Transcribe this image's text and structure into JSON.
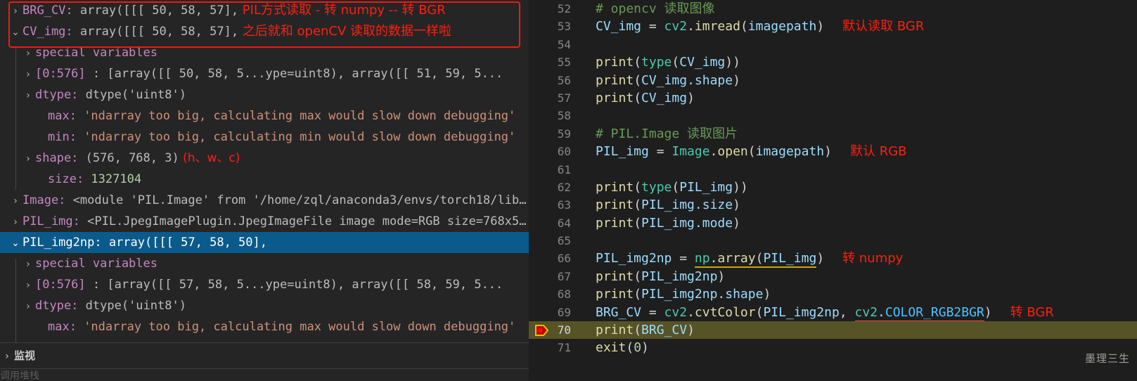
{
  "debug_panel": {
    "variables": [
      {
        "indent": 1,
        "chevron": "›",
        "expanded": false,
        "name": "BRG_CV:",
        "value": "array([[[ 50,  58,  57],",
        "annotation": "PIL方式读取 - 转 numpy -- 转 BGR",
        "selected": false,
        "value_kind": "plain"
      },
      {
        "indent": 1,
        "chevron": "⌄",
        "expanded": true,
        "name": "CV_img:",
        "value": "array([[[ 50,  58,  57],",
        "annotation": "之后就和 openCV 读取的数据一样啦",
        "selected": false,
        "value_kind": "plain"
      },
      {
        "indent": 2,
        "chevron": "›",
        "expanded": false,
        "name": "special variables",
        "value": "",
        "annotation": "",
        "selected": false,
        "value_kind": "plain"
      },
      {
        "indent": 2,
        "chevron": "›",
        "expanded": false,
        "name": "[0:576]",
        "value": ": [array([[ 50,  58,  5...ype=uint8), array([[ 51,  59,  5...",
        "annotation": "",
        "selected": false,
        "value_kind": "plain"
      },
      {
        "indent": 2,
        "chevron": "›",
        "expanded": false,
        "name": "dtype:",
        "value": "dtype('uint8')",
        "annotation": "",
        "selected": false,
        "value_kind": "plain"
      },
      {
        "indent": 3,
        "chevron": "",
        "expanded": false,
        "name": "max:",
        "value": "'ndarray too big, calculating max would slow down debugging'",
        "annotation": "",
        "selected": false,
        "value_kind": "str"
      },
      {
        "indent": 3,
        "chevron": "",
        "expanded": false,
        "name": "min:",
        "value": "'ndarray too big, calculating min would slow down debugging'",
        "annotation": "",
        "selected": false,
        "value_kind": "str"
      },
      {
        "indent": 2,
        "chevron": "›",
        "expanded": false,
        "name": "shape:",
        "value": "(576, 768, 3)",
        "annotation": "(h、w、c)",
        "selected": false,
        "value_kind": "plain"
      },
      {
        "indent": 3,
        "chevron": "",
        "expanded": false,
        "name": "size:",
        "value": "1327104",
        "annotation": "",
        "selected": false,
        "value_kind": "num"
      },
      {
        "indent": 1,
        "chevron": "›",
        "expanded": false,
        "name": "Image:",
        "value": "<module 'PIL.Image' from '/home/zql/anaconda3/envs/torch18/lib…",
        "annotation": "",
        "selected": false,
        "value_kind": "plain"
      },
      {
        "indent": 1,
        "chevron": "›",
        "expanded": false,
        "name": "PIL_img:",
        "value": "<PIL.JpegImagePlugin.JpegImageFile image mode=RGB size=768x5…",
        "annotation": "",
        "selected": false,
        "value_kind": "plain"
      },
      {
        "indent": 1,
        "chevron": "⌄",
        "expanded": true,
        "name": "PIL_img2np:",
        "value": "array([[[ 57,  58,  50],",
        "annotation": "",
        "selected": true,
        "value_kind": "plain"
      },
      {
        "indent": 2,
        "chevron": "›",
        "expanded": false,
        "name": "special variables",
        "value": "",
        "annotation": "",
        "selected": false,
        "value_kind": "plain"
      },
      {
        "indent": 2,
        "chevron": "›",
        "expanded": false,
        "name": "[0:576]",
        "value": ": [array([[ 57,  58,  5...ype=uint8), array([[ 58,  59,  5...",
        "annotation": "",
        "selected": false,
        "value_kind": "plain"
      },
      {
        "indent": 2,
        "chevron": "›",
        "expanded": false,
        "name": "dtype:",
        "value": "dtype('uint8')",
        "annotation": "",
        "selected": false,
        "value_kind": "plain"
      },
      {
        "indent": 3,
        "chevron": "",
        "expanded": false,
        "name": "max:",
        "value": "'ndarray too big, calculating max would slow down debugging'",
        "annotation": "",
        "selected": false,
        "value_kind": "str"
      }
    ],
    "watch": {
      "chevron": "›",
      "label": "监视",
      "ghost_label": "调用堆栈"
    }
  },
  "editor": {
    "lines": [
      {
        "num": "52",
        "current": false,
        "tokens": [
          {
            "t": "# opencv 读取图像",
            "c": "t-com"
          }
        ],
        "annotation": ""
      },
      {
        "num": "53",
        "current": false,
        "tokens": [
          {
            "t": "CV_img",
            "c": "t-var"
          },
          {
            "t": " = ",
            "c": "t-op"
          },
          {
            "t": "cv2",
            "c": "t-mod"
          },
          {
            "t": ".",
            "c": "t-punc"
          },
          {
            "t": "imread",
            "c": "t-fn"
          },
          {
            "t": "(",
            "c": "t-punc"
          },
          {
            "t": "imagepath",
            "c": "t-var"
          },
          {
            "t": ")",
            "c": "t-punc"
          }
        ],
        "annotation": "默认读取 BGR"
      },
      {
        "num": "54",
        "current": false,
        "tokens": [],
        "annotation": ""
      },
      {
        "num": "55",
        "current": false,
        "tokens": [
          {
            "t": "print",
            "c": "t-fn"
          },
          {
            "t": "(",
            "c": "t-punc"
          },
          {
            "t": "type",
            "c": "t-mod"
          },
          {
            "t": "(",
            "c": "t-punc"
          },
          {
            "t": "CV_img",
            "c": "t-var"
          },
          {
            "t": "))",
            "c": "t-punc"
          }
        ],
        "annotation": ""
      },
      {
        "num": "56",
        "current": false,
        "tokens": [
          {
            "t": "print",
            "c": "t-fn"
          },
          {
            "t": "(",
            "c": "t-punc"
          },
          {
            "t": "CV_img",
            "c": "t-var"
          },
          {
            "t": ".shape",
            "c": "t-var"
          },
          {
            "t": ")",
            "c": "t-punc"
          }
        ],
        "annotation": ""
      },
      {
        "num": "57",
        "current": false,
        "tokens": [
          {
            "t": "print",
            "c": "t-fn"
          },
          {
            "t": "(",
            "c": "t-punc"
          },
          {
            "t": "CV_img",
            "c": "t-var"
          },
          {
            "t": ")",
            "c": "t-punc"
          }
        ],
        "annotation": ""
      },
      {
        "num": "58",
        "current": false,
        "tokens": [],
        "annotation": ""
      },
      {
        "num": "59",
        "current": false,
        "tokens": [
          {
            "t": "# PIL.Image 读取图片",
            "c": "t-com"
          }
        ],
        "annotation": ""
      },
      {
        "num": "60",
        "current": false,
        "tokens": [
          {
            "t": "PIL_img",
            "c": "t-var"
          },
          {
            "t": " = ",
            "c": "t-op"
          },
          {
            "t": "Image",
            "c": "t-mod"
          },
          {
            "t": ".",
            "c": "t-punc"
          },
          {
            "t": "open",
            "c": "t-fn"
          },
          {
            "t": "(",
            "c": "t-punc"
          },
          {
            "t": "imagepath",
            "c": "t-var"
          },
          {
            "t": ")",
            "c": "t-punc"
          }
        ],
        "annotation": "默认 RGB"
      },
      {
        "num": "61",
        "current": false,
        "tokens": [],
        "annotation": ""
      },
      {
        "num": "62",
        "current": false,
        "tokens": [
          {
            "t": "print",
            "c": "t-fn"
          },
          {
            "t": "(",
            "c": "t-punc"
          },
          {
            "t": "type",
            "c": "t-mod"
          },
          {
            "t": "(",
            "c": "t-punc"
          },
          {
            "t": "PIL_img",
            "c": "t-var"
          },
          {
            "t": "))",
            "c": "t-punc"
          }
        ],
        "annotation": ""
      },
      {
        "num": "63",
        "current": false,
        "tokens": [
          {
            "t": "print",
            "c": "t-fn"
          },
          {
            "t": "(",
            "c": "t-punc"
          },
          {
            "t": "PIL_img",
            "c": "t-var"
          },
          {
            "t": ".size",
            "c": "t-var"
          },
          {
            "t": ")",
            "c": "t-punc"
          }
        ],
        "annotation": ""
      },
      {
        "num": "64",
        "current": false,
        "tokens": [
          {
            "t": "print",
            "c": "t-fn"
          },
          {
            "t": "(",
            "c": "t-punc"
          },
          {
            "t": "PIL_img",
            "c": "t-var"
          },
          {
            "t": ".mode",
            "c": "t-var"
          },
          {
            "t": ")",
            "c": "t-punc"
          }
        ],
        "annotation": ""
      },
      {
        "num": "65",
        "current": false,
        "tokens": [],
        "annotation": ""
      },
      {
        "num": "66",
        "current": false,
        "tokens": [
          {
            "t": "PIL_img2np",
            "c": "t-var"
          },
          {
            "t": " = ",
            "c": "t-op"
          },
          {
            "t": "np",
            "c": "t-mod squig-warn"
          },
          {
            "t": ".",
            "c": "t-punc squig-warn"
          },
          {
            "t": "array",
            "c": "t-fn squig-warn"
          },
          {
            "t": "(",
            "c": "t-punc squig-warn"
          },
          {
            "t": "PIL_img",
            "c": "t-var squig-warn"
          },
          {
            "t": ")",
            "c": "t-punc"
          }
        ],
        "annotation": "转 numpy"
      },
      {
        "num": "67",
        "current": false,
        "tokens": [
          {
            "t": "print",
            "c": "t-fn"
          },
          {
            "t": "(",
            "c": "t-punc"
          },
          {
            "t": "PIL_img2np",
            "c": "t-var"
          },
          {
            "t": ")",
            "c": "t-punc"
          }
        ],
        "annotation": ""
      },
      {
        "num": "68",
        "current": false,
        "tokens": [
          {
            "t": "print",
            "c": "t-fn"
          },
          {
            "t": "(",
            "c": "t-punc"
          },
          {
            "t": "PIL_img2np",
            "c": "t-var"
          },
          {
            "t": ".shape",
            "c": "t-var"
          },
          {
            "t": ")",
            "c": "t-punc"
          }
        ],
        "annotation": ""
      },
      {
        "num": "69",
        "current": false,
        "tokens": [
          {
            "t": "BRG_CV",
            "c": "t-var"
          },
          {
            "t": " = ",
            "c": "t-op"
          },
          {
            "t": "cv2",
            "c": "t-mod"
          },
          {
            "t": ".",
            "c": "t-punc"
          },
          {
            "t": "cvtColor",
            "c": "t-fn"
          },
          {
            "t": "(",
            "c": "t-punc"
          },
          {
            "t": "PIL_img2np",
            "c": "t-var"
          },
          {
            "t": ", ",
            "c": "t-punc"
          },
          {
            "t": "cv2",
            "c": "t-mod squig-err"
          },
          {
            "t": ".",
            "c": "t-punc squig-err"
          },
          {
            "t": "COLOR_RGB2BGR",
            "c": "t-const squig-err"
          },
          {
            "t": ")",
            "c": "t-punc"
          }
        ],
        "annotation": "转 BGR"
      },
      {
        "num": "70",
        "current": true,
        "tokens": [
          {
            "t": "print",
            "c": "t-fn"
          },
          {
            "t": "(",
            "c": "t-punc"
          },
          {
            "t": "BRG_CV",
            "c": "t-var"
          },
          {
            "t": ")",
            "c": "t-punc"
          }
        ],
        "annotation": ""
      },
      {
        "num": "71",
        "current": false,
        "tokens": [
          {
            "t": "exit",
            "c": "t-fn"
          },
          {
            "t": "(",
            "c": "t-punc"
          },
          {
            "t": "0",
            "c": "t-num"
          },
          {
            "t": ")",
            "c": "t-punc"
          }
        ],
        "annotation": ""
      }
    ],
    "debug_pointer_line": "70",
    "watermark": "墨理三生"
  },
  "colors": {
    "annotation_red": "#ff1f0f",
    "selection_blue": "#0a5a8c",
    "current_line": "#565327",
    "editor_bg": "#1e1e1e",
    "panel_bg": "#252526",
    "comment_green": "#6a9955",
    "variable_blue": "#9cdcfe",
    "function_yellow": "#dcdcaa",
    "module_teal": "#4ec9b0",
    "constant_cyan": "#4fc1ff",
    "string_orange": "#ce9178",
    "number_green": "#b5cea8",
    "varname_purple": "#c586c0"
  }
}
